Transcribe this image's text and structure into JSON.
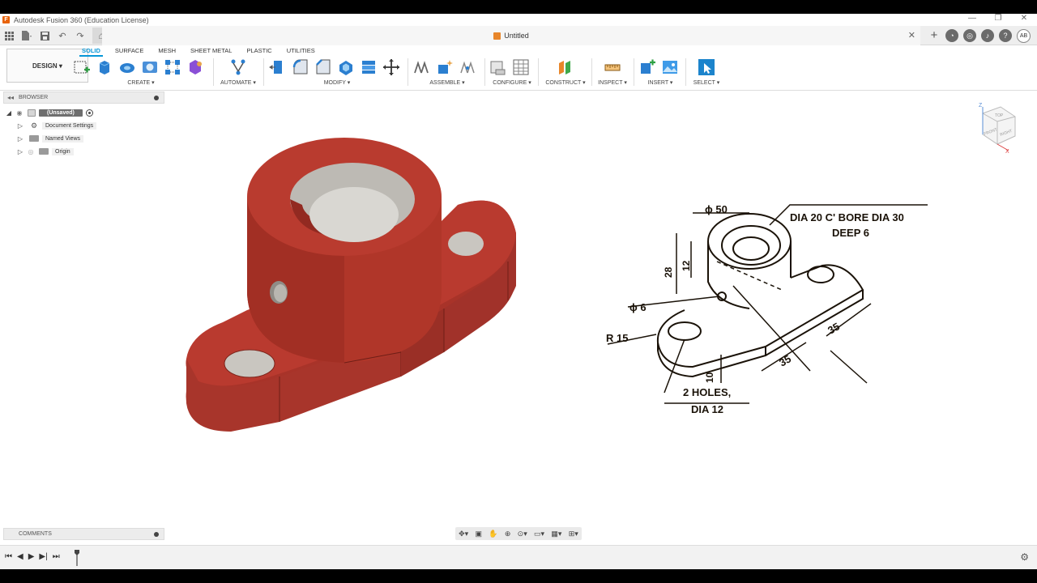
{
  "window": {
    "title": "Autodesk Fusion 360 (Education License)",
    "controls": [
      "—",
      "❐",
      "✕"
    ]
  },
  "document_tab": {
    "title": "Untitled",
    "close": "✕"
  },
  "user": {
    "initials": "AB"
  },
  "ribbon": {
    "workspace_label": "DESIGN ▾",
    "tabs": [
      {
        "label": "SOLID",
        "active": true
      },
      {
        "label": "SURFACE",
        "active": false
      },
      {
        "label": "MESH",
        "active": false
      },
      {
        "label": "SHEET METAL",
        "active": false
      },
      {
        "label": "PLASTIC",
        "active": false
      },
      {
        "label": "UTILITIES",
        "active": false
      }
    ],
    "groups": {
      "create": "CREATE ▾",
      "automate": "AUTOMATE ▾",
      "modify": "MODIFY ▾",
      "assemble": "ASSEMBLE ▾",
      "configure": "CONFIGURE ▾",
      "construct": "CONSTRUCT ▾",
      "inspect": "INSPECT ▾",
      "insert": "INSERT ▾",
      "select": "SELECT ▾"
    }
  },
  "browser": {
    "title": "BROWSER",
    "root_label": "(Unsaved)",
    "items": [
      {
        "label": "Document Settings",
        "icon": "gear-icon"
      },
      {
        "label": "Named Views",
        "icon": "folder-icon"
      },
      {
        "label": "Origin",
        "icon": "folder-icon"
      }
    ]
  },
  "comments": {
    "title": "COMMENTS"
  },
  "viewcube": {
    "axis_z": "Z",
    "axis_x": "X",
    "face_top": "TOP",
    "face_front": "FRONT",
    "face_right": "RIGHT"
  },
  "drawing": {
    "labels": {
      "dia50": "ϕ 50",
      "cbore_line1": "DIA 20 C' BORE DIA 30",
      "cbore_line2": "DEEP 6",
      "dim28": "28",
      "dim12": "12",
      "dia6": "ϕ 6",
      "r15": "R 15",
      "dim35a": "35",
      "dim35b": "35",
      "dim10": "10",
      "holes_line1": "2 HOLES,",
      "holes_line2": "DIA 12"
    }
  },
  "colors": {
    "part_face": "#b3382c",
    "part_dark": "#8f2a20",
    "accent": "#0696d7",
    "hole": "#d9d7d2"
  }
}
